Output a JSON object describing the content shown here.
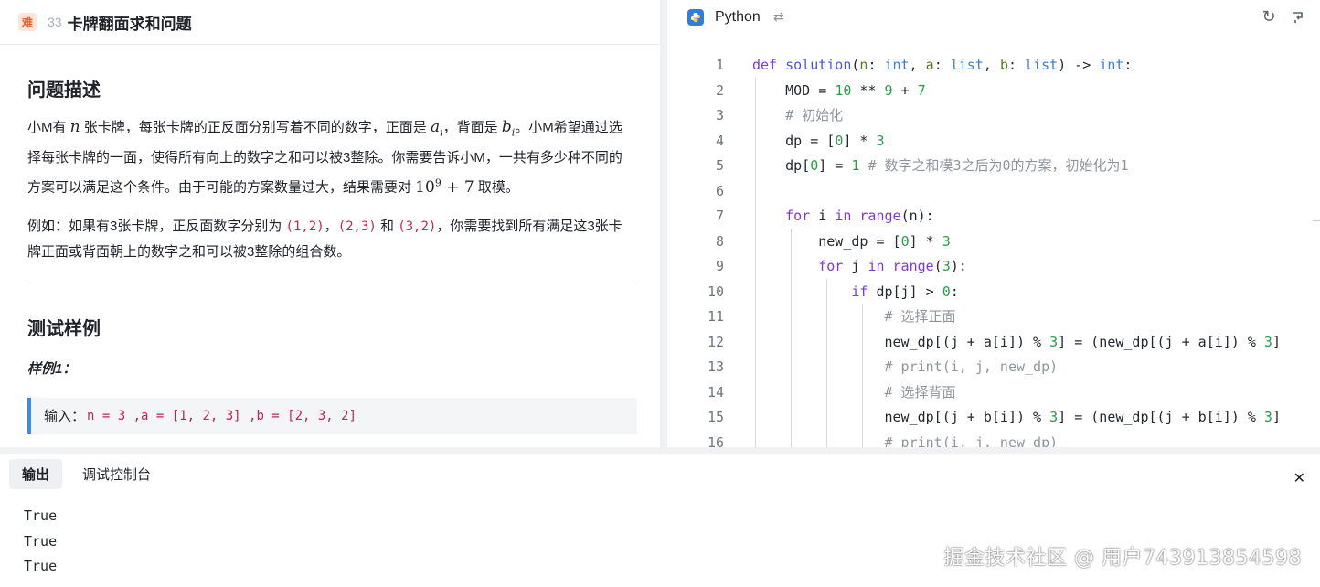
{
  "problem": {
    "difficulty": "难",
    "number": "33",
    "title": "卡牌翻面求和问题",
    "desc_heading": "问题描述",
    "para1": {
      "a": "小M有 ",
      "n": "n",
      "b": " 张卡牌，每张卡牌的正反面分别写着不同的数字，正面是 ",
      "ai": "a",
      "ai_sub": "i",
      "c": "，背面是 ",
      "bi": "b",
      "bi_sub": "i",
      "d": "。小M希望通过选择每张卡牌的一面，使得所有向上的数字之和可以被3整除。你需要告诉小M，一共有多少种不同的方案可以满足这个条件。由于可能的方案数量过大，结果需要对 ",
      "mod": "10",
      "mod_exp": "9",
      "mod_rest": " + 7",
      "e": " 取模。"
    },
    "para2": {
      "a": "例如：如果有3张卡牌，正反面数字分别为 ",
      "p1": "(1,2)",
      "sep1": "，",
      "p2": "(2,3)",
      "and": " 和 ",
      "p3": "(3,2)",
      "b": "，你需要找到所有满足这3张卡牌正面或背面朝上的数字之和可以被3整除的组合数。"
    },
    "test_heading": "测试样例",
    "example_label": "样例1：",
    "example_input_label": "输入：",
    "example_input_value": "n = 3 ,a = [1, 2, 3] ,b = [2, 3, 2]"
  },
  "editor": {
    "language": "Python",
    "swap_icon": "swap-icon",
    "refresh_icon": "refresh-icon",
    "reset_icon": "reset-icon",
    "line_numbers": [
      "1",
      "2",
      "3",
      "4",
      "5",
      "6",
      "7",
      "8",
      "9",
      "10",
      "11",
      "12",
      "13",
      "14",
      "15",
      "16"
    ]
  },
  "output_panel": {
    "tabs": [
      "输出",
      "调试控制台"
    ],
    "active_tab": "输出",
    "lines": [
      "True",
      "True",
      "True"
    ],
    "close_icon": "close-icon"
  },
  "watermark": "掘金技术社区 @ 用户743913854598",
  "colors": {
    "keyword": "#7e3ad8",
    "function": "#4b58d8",
    "type": "#3a7fd8",
    "number": "#2a9d4a",
    "comment": "#8e959e",
    "accent_bar": "#3c8dde",
    "difficulty": "#e8612c"
  }
}
